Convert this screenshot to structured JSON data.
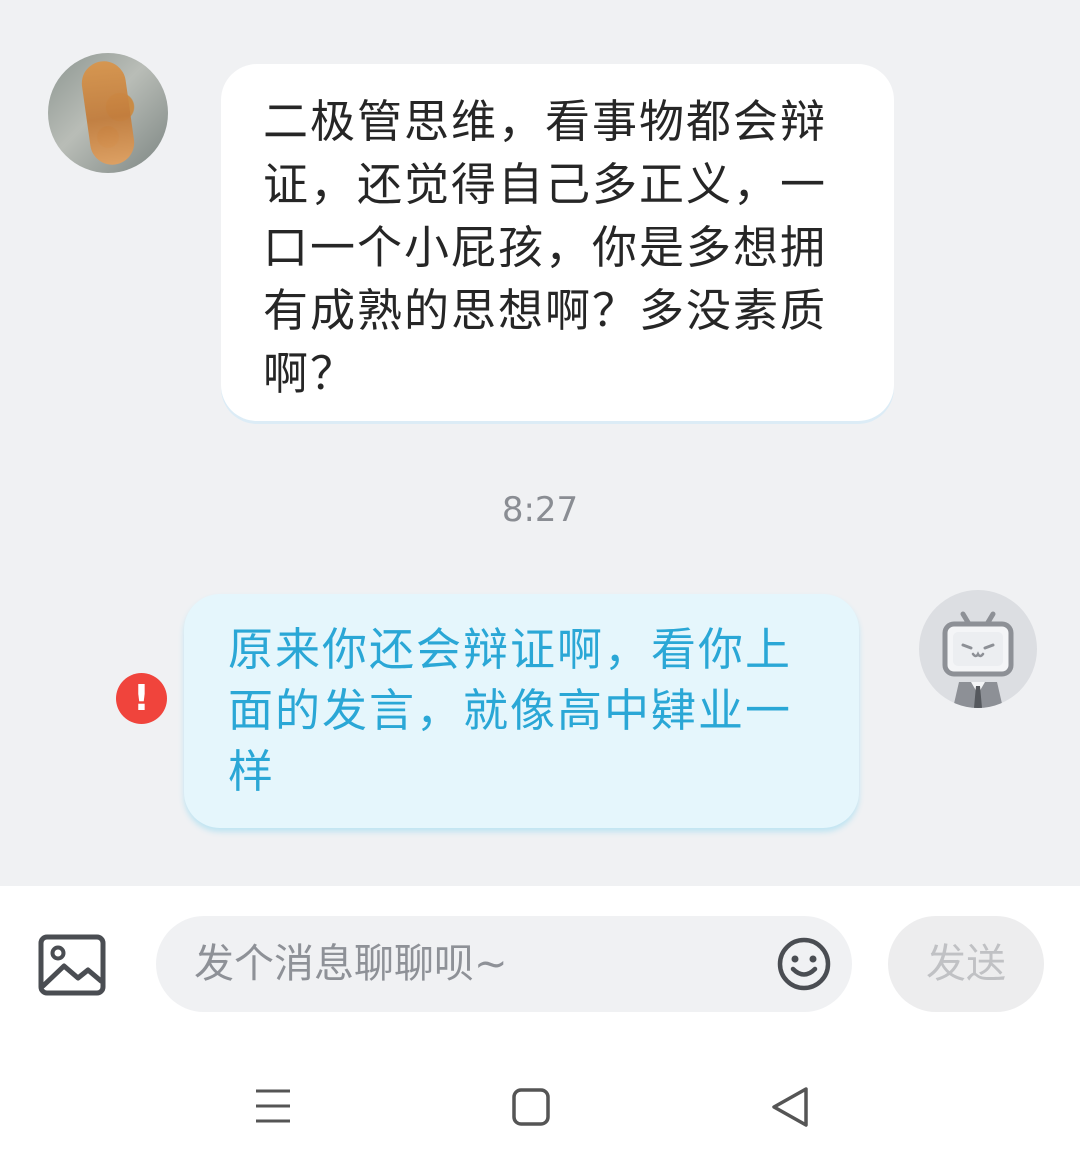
{
  "messages": [
    {
      "direction": "incoming",
      "text": "二极管思维，看事物都会辩证，还觉得自己多正义，一口一个小屁孩，你是多想拥有成熟的思想啊？多没素质啊？"
    },
    {
      "direction": "outgoing",
      "text": "原来你还会辩证啊，看你上面的发言，就像高中肄业一样",
      "status": "failed"
    }
  ],
  "timestamp": "8:27",
  "composer": {
    "placeholder": "发个消息聊聊呗~",
    "send_label": "发送"
  },
  "icons": {
    "error": "error-exclamation-icon",
    "image": "image-icon",
    "emoji": "emoji-icon",
    "nav_menu": "menu-icon",
    "nav_home": "home-square-icon",
    "nav_back": "back-triangle-icon"
  },
  "colors": {
    "chat_background": "#f0f1f3",
    "incoming_bubble": "#ffffff",
    "outgoing_bubble": "#e5f6fc",
    "outgoing_text": "#2aa7d6",
    "error": "#f0443c"
  }
}
